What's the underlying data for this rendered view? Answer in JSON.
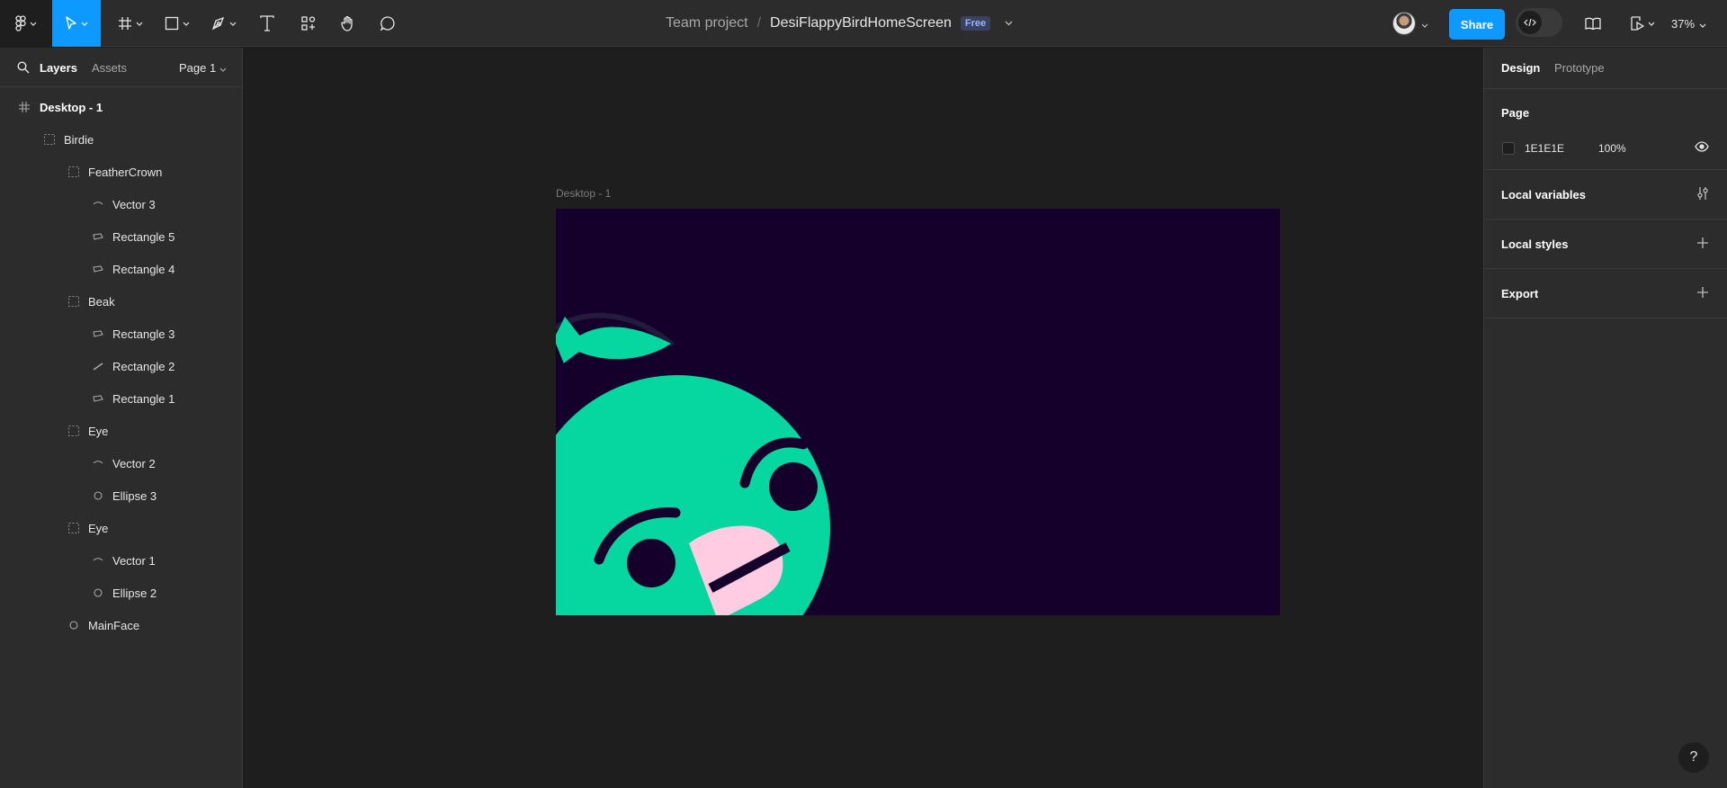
{
  "toolbar": {
    "project": "Team project",
    "separator": "/",
    "file_name": "DesiFlappyBirdHomeScreen",
    "plan_badge": "Free",
    "share_label": "Share",
    "zoom": "37%"
  },
  "left_panel": {
    "tabs": [
      "Layers",
      "Assets"
    ],
    "page_selector": "Page 1",
    "layers": [
      {
        "name": "Desktop - 1",
        "icon": "frame-icon",
        "depth": 0
      },
      {
        "name": "Birdie",
        "icon": "group-icon",
        "depth": 1
      },
      {
        "name": "FeatherCrown",
        "icon": "group-icon",
        "depth": 2
      },
      {
        "name": "Vector 3",
        "icon": "vector-icon",
        "depth": 3
      },
      {
        "name": "Rectangle 5",
        "icon": "shape-icon",
        "depth": 3
      },
      {
        "name": "Rectangle 4",
        "icon": "shape-icon",
        "depth": 3
      },
      {
        "name": "Beak",
        "icon": "group-icon",
        "depth": 2
      },
      {
        "name": "Rectangle 3",
        "icon": "shape-icon",
        "depth": 3
      },
      {
        "name": "Rectangle 2",
        "icon": "line-icon",
        "depth": 3
      },
      {
        "name": "Rectangle 1",
        "icon": "shape-icon",
        "depth": 3
      },
      {
        "name": "Eye",
        "icon": "group-icon",
        "depth": 2
      },
      {
        "name": "Vector 2",
        "icon": "vector-icon",
        "depth": 3
      },
      {
        "name": "Ellipse 3",
        "icon": "ellipse-icon",
        "depth": 3
      },
      {
        "name": "Eye",
        "icon": "group-icon",
        "depth": 2
      },
      {
        "name": "Vector 1",
        "icon": "vector-icon",
        "depth": 3
      },
      {
        "name": "Ellipse 2",
        "icon": "ellipse-icon",
        "depth": 3
      },
      {
        "name": "MainFace",
        "icon": "ellipse-icon",
        "depth": 2
      }
    ]
  },
  "canvas": {
    "frame_label": "Desktop - 1",
    "colors": {
      "frame_bg": "#14002a",
      "bird_body": "#06d6a0",
      "beak": "#ffcce1",
      "dark": "#14002a"
    }
  },
  "right_panel": {
    "tabs": [
      "Design",
      "Prototype"
    ],
    "page_title": "Page",
    "page_color": "1E1E1E",
    "page_opacity": "100%",
    "sections": [
      "Local variables",
      "Local styles",
      "Export"
    ]
  },
  "help_label": "?"
}
